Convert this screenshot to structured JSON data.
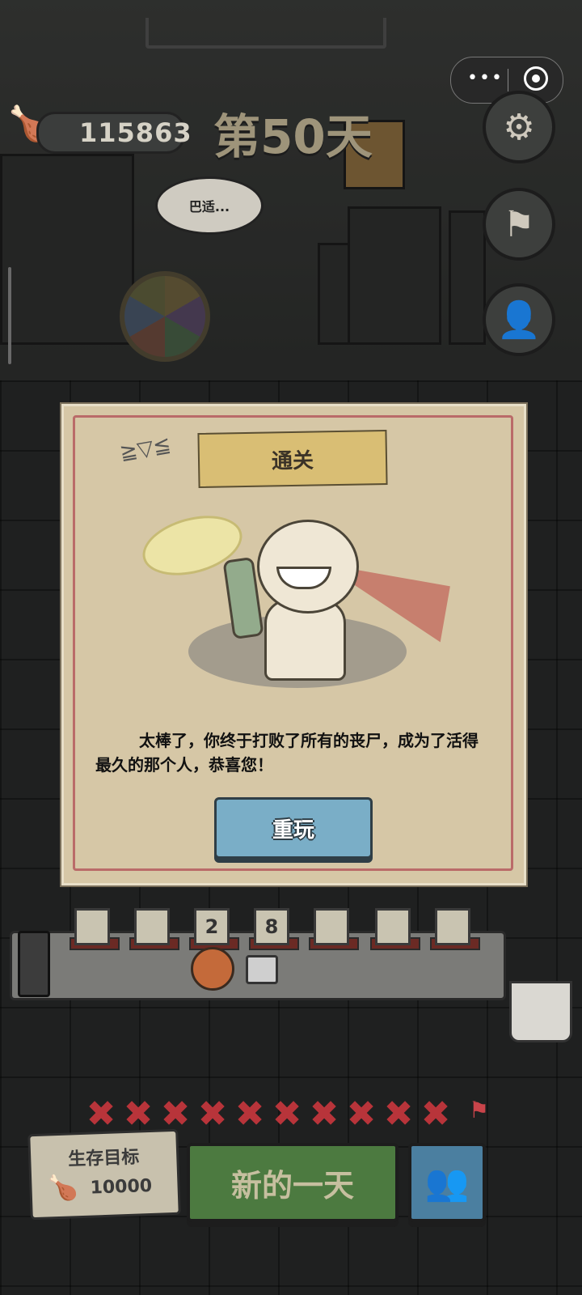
{
  "miniprogram_capsule": {
    "more_icon": "more-dots-icon",
    "close_icon": "target-circle-icon"
  },
  "resources": {
    "meat_count": "115863"
  },
  "day_label": "第50天",
  "speech_bubble": "巴适...",
  "side_buttons": [
    {
      "name": "settings",
      "icon": "gear-icon"
    },
    {
      "name": "flag",
      "icon": "flag-icon"
    },
    {
      "name": "user-search",
      "icon": "user-search-icon"
    }
  ],
  "dialog": {
    "title": "通关",
    "message": "太棒了，你终于打败了所有的丧尸，成为了活得最久的那个人，恭喜您！",
    "button_label": "重玩"
  },
  "table_slots": [
    "",
    "",
    "2",
    "8",
    "",
    "",
    ""
  ],
  "day_progress": {
    "crossed_days": 10,
    "flag": true
  },
  "survival_goal": {
    "title": "生存目标",
    "value": "10000"
  },
  "new_day_button": "新的一天",
  "colors": {
    "accent_red": "#b8343a",
    "button_blue": "#7aaec7",
    "button_green": "#4c7a40",
    "paper": "#d6c7a6"
  }
}
